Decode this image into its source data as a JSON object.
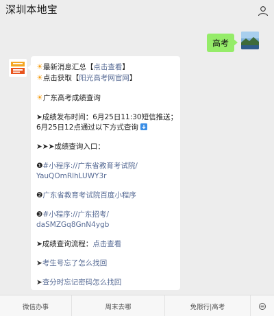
{
  "header": {
    "title": "深圳本地宝"
  },
  "user_message": {
    "text": "高考"
  },
  "bot_message": {
    "line1_prefix": "最新消息汇总【",
    "line1_link": "点击查看",
    "line1_suffix": "】",
    "line2_prefix": "点击获取【",
    "line2_link": "阳光高考网官网",
    "line2_suffix": "】",
    "line3": "广东高考成绩查询",
    "line4": "➤成绩发布时间：6月25日11:30短信推送；",
    "line5": "6月25日12点通过以下方式查询",
    "line6": "➤➤➤成绩查询入口：",
    "line7_num": "❶",
    "line7_link": "#小程序://广东省教育考试院/",
    "line8_link": "YauQOmRlhLUWY3r",
    "line9_num": "❷",
    "line9_link": "广东省教育考试院百度小程序",
    "line10_num": "❸",
    "line10_link": "#小程序://广东招考/",
    "line11_link": "daSMZGq8GnN4ygb",
    "line12_prefix": "➤成绩查询流程：",
    "line12_link": "点击查看",
    "line13_arrow": "➤",
    "line13_link": "考生号忘了怎么找回",
    "line14_arrow": "➤",
    "line14_link": "查分时忘记密码怎么找回"
  },
  "menu": {
    "items": [
      "微信办事",
      "周末去哪",
      "免限行|高考"
    ]
  },
  "colors": {
    "background": "#ededed",
    "user_bubble": "#95ec69",
    "link": "#576b95",
    "sun": "#f39c12"
  },
  "icons": [
    "profile-icon",
    "sun-icon",
    "down-arrow-icon",
    "grid-menu-icon"
  ]
}
